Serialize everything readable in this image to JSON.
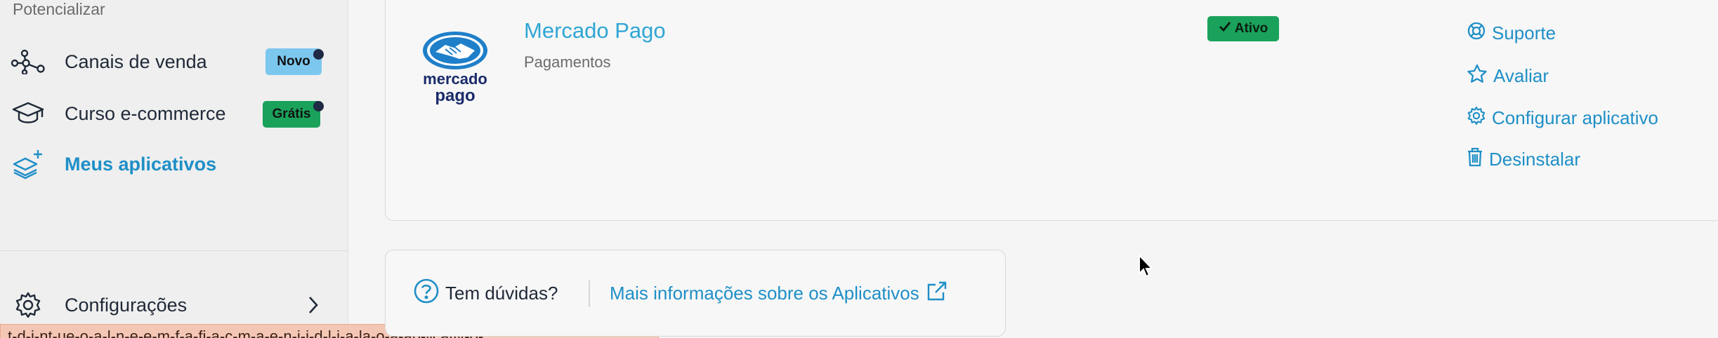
{
  "sidebar": {
    "section_label": "Potencializar",
    "items": [
      {
        "label": "Canais de venda",
        "icon": "share-network-icon",
        "badge": "Novo",
        "badge_color": "#7cc7ee"
      },
      {
        "label": "Curso e-commerce",
        "icon": "graduation-cap-icon",
        "badge": "Grátis",
        "badge_color": "#1aa25b"
      },
      {
        "label": "Meus aplicativos",
        "icon": "apps-stack-icon",
        "active": true
      }
    ],
    "settings_label": "Configurações"
  },
  "app": {
    "name": "Mercado Pago",
    "category": "Pagamentos",
    "logo_text_line1": "mercado",
    "logo_text_line2": "pago",
    "status": "Ativo",
    "actions": [
      {
        "label": "Suporte",
        "icon": "lifebuoy-icon"
      },
      {
        "label": "Avaliar",
        "icon": "star-icon"
      },
      {
        "label": "Configurar aplicativo",
        "icon": "gear-icon"
      },
      {
        "label": "Desinstalar",
        "icon": "trash-icon"
      }
    ]
  },
  "help": {
    "question": "Tem dúvidas?",
    "link": "Mais informações sobre os Aplicativos"
  },
  "tooltip": {
    "text": "t-d-i-nt-ue-o-a-l-n-e-e-m-f-a-fi-a-c-m-a-e-n-i-i-d-l-i-a-la-o-a-ap-licativ-o-"
  },
  "colors": {
    "accent": "#1f8fc7",
    "app_name": "#2fa6d4",
    "success": "#1aa25b"
  }
}
